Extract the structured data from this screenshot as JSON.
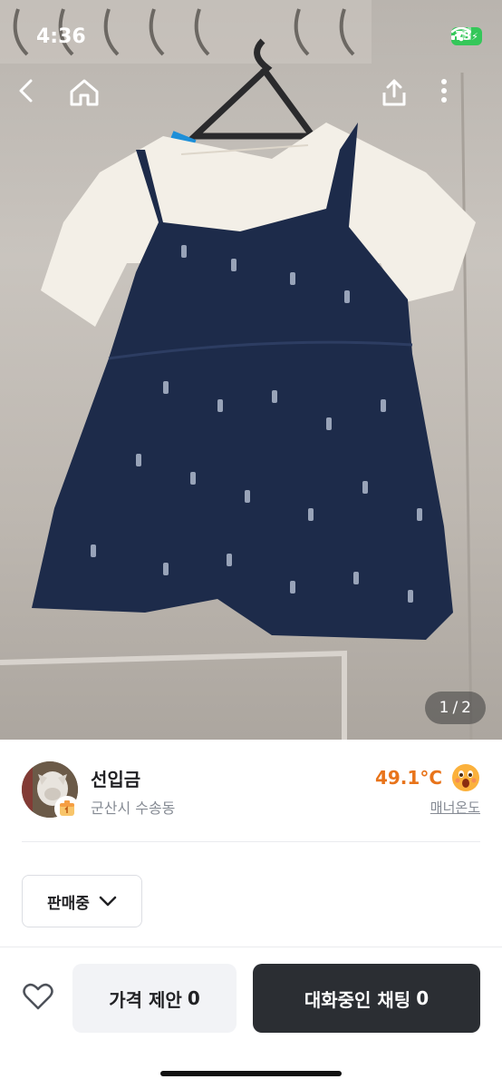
{
  "status_bar": {
    "time": "4:36",
    "battery": "73"
  },
  "nav": {
    "back_icon": "back-arrow-icon",
    "home_icon": "home-icon",
    "share_icon": "share-icon",
    "more_icon": "more-vertical-icon"
  },
  "gallery": {
    "current": "1",
    "separator": "/",
    "total": "2"
  },
  "seller": {
    "name": "선입금",
    "location": "군산시 수송동",
    "temperature": "49.1°C",
    "manner_label": "매너온도"
  },
  "product_status": {
    "selected": "판매중"
  },
  "actions": {
    "offer_label": "가격 제안",
    "offer_count": "0",
    "chat_label": "대화중인 채팅",
    "chat_count": "0"
  },
  "colors": {
    "accent": "#e8741b",
    "chat_button": "#2b2e33",
    "offer_button": "#f2f3f6",
    "battery": "#34c759"
  }
}
